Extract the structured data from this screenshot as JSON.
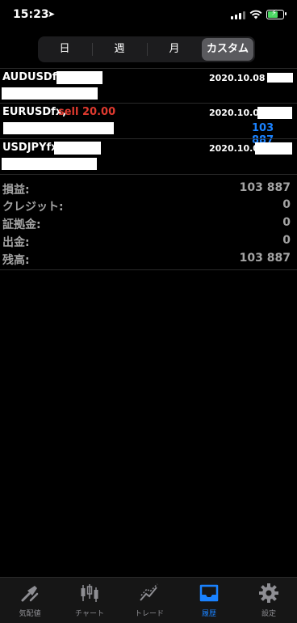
{
  "status": {
    "time": "15:23",
    "location_icon": "location-arrow-icon"
  },
  "segments": [
    {
      "label": "日"
    },
    {
      "label": "週"
    },
    {
      "label": "月"
    },
    {
      "label": "カスタム",
      "active": true
    }
  ],
  "deals": [
    {
      "symbol": "AUDUSDfx,",
      "detail": "",
      "date": "2020.10.08",
      "profit": ""
    },
    {
      "symbol": "EURUSDfx,",
      "detail": "sell 20.00",
      "date": "2020.10.08",
      "profit": "103 887"
    },
    {
      "symbol": "USDJPYfx,",
      "detail": "",
      "date": "2020.10.08",
      "profit": ""
    }
  ],
  "summary": [
    {
      "label": "損益:",
      "value": "103 887"
    },
    {
      "label": "クレジット:",
      "value": "0"
    },
    {
      "label": "証拠金:",
      "value": "0"
    },
    {
      "label": "出金:",
      "value": "0"
    },
    {
      "label": "残高:",
      "value": "103 887"
    }
  ],
  "tabs": [
    {
      "label": "気配値",
      "icon": "quotes-icon"
    },
    {
      "label": "チャート",
      "icon": "candlestick-chart-icon"
    },
    {
      "label": "トレード",
      "icon": "trade-chart-icon"
    },
    {
      "label": "履歴",
      "icon": "history-inbox-icon",
      "active": true
    },
    {
      "label": "設定",
      "icon": "gear-icon"
    }
  ],
  "colors": {
    "accent": "#1a82ff",
    "sell": "#e03a2f",
    "summary_text": "#a4a4a4"
  }
}
